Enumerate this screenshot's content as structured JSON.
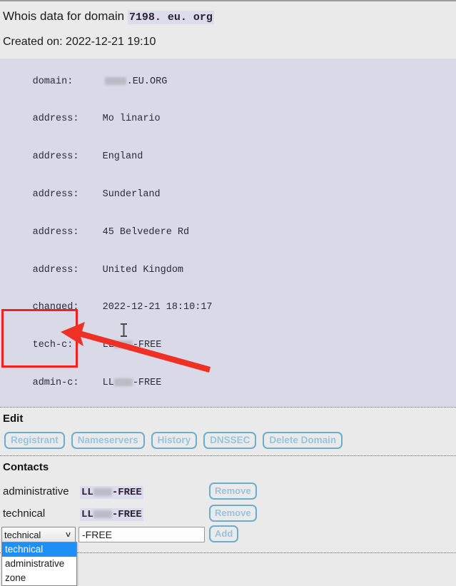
{
  "page": {
    "title_prefix": "Whois data for domain",
    "domain": "7198. eu. org",
    "created_label": "Created on: 2022-12-21 19:10"
  },
  "whois": {
    "rows": [
      {
        "key": "domain:",
        "value": ".EU.ORG",
        "redacted": "domain"
      },
      {
        "key": "address:",
        "value": "Mo linario",
        "redacted": "none"
      },
      {
        "key": "address:",
        "value": "England",
        "redacted": "none"
      },
      {
        "key": "address:",
        "value": "Sunderland",
        "redacted": "none"
      },
      {
        "key": "address:",
        "value": "45 Belvedere Rd",
        "redacted": "none"
      },
      {
        "key": "address:",
        "value": "United Kingdom",
        "redacted": "none"
      },
      {
        "key": "changed:",
        "value": "2022-12-21 18:10:17",
        "redacted": "none"
      },
      {
        "key": "tech-c:",
        "value": "-FREE",
        "redacted": "contact"
      },
      {
        "key": "admin-c:",
        "value": "-FREE",
        "redacted": "contact"
      }
    ]
  },
  "edit": {
    "heading": "Edit",
    "buttons": [
      {
        "label": "Registrant"
      },
      {
        "label": "Nameservers"
      },
      {
        "label": "History"
      },
      {
        "label": "DNSSEC"
      },
      {
        "label": "Delete Domain"
      }
    ]
  },
  "contacts": {
    "heading": "Contacts",
    "rows": [
      {
        "type": "administrative",
        "id_prefix": "LL",
        "id_suffix": "-FREE",
        "action": "Remove"
      },
      {
        "type": "technical",
        "id_prefix": "LL",
        "id_suffix": "-FREE",
        "action": "Remove"
      }
    ],
    "add_form": {
      "select_value": "technical",
      "select_options": [
        "technical",
        "administrative",
        "zone"
      ],
      "selected_option_index": 0,
      "input_value": "-FREE",
      "input_placeholder": "",
      "add_label": "Add"
    }
  },
  "annotation": {
    "color": "#f32020"
  }
}
